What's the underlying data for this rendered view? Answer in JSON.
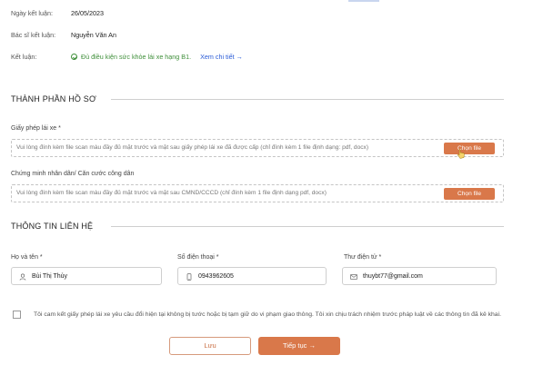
{
  "conclusion_info": {
    "date_label": "Ngày kết luận:",
    "date_value": "26/05/2023",
    "doctor_label": "Bác sĩ kết luận:",
    "doctor_value": "Nguyễn Văn An",
    "result_label": "Kết luận:",
    "result_value": "Đủ điều kiện sức khỏe lái xe hạng B1.",
    "detail_link": "Xem chi tiết",
    "detail_arrow": "→",
    "result_color": "#3f8f3a"
  },
  "documents": {
    "title": "THÀNH PHẦN HỒ SƠ",
    "license": {
      "label": "Giấy phép lái xe *",
      "hint": "Vui lòng đính kèm file scan màu đầy đủ mặt trước và mặt sau giấy phép lái xe đã được cấp (chỉ đính kèm 1 file định dạng: pdf, docx)",
      "button": "Chọn file"
    },
    "id_card": {
      "label": "Chứng minh nhân dân/ Căn cước công dân",
      "hint": "Vui lòng đính kèm file scan màu đầy đủ mặt trước và mặt sau CMND/CCCD (chỉ đính kèm 1 file định dạng pdf, docx)",
      "button": "Chọn file"
    }
  },
  "contact": {
    "title": "THÔNG TIN LIÊN HỆ",
    "name": {
      "label": "Họ và tên *",
      "value": "Bùi Thị Thủy",
      "icon": "user-icon"
    },
    "phone": {
      "label": "Số điện thoại *",
      "value": "0943962605",
      "icon": "phone-icon"
    },
    "email": {
      "label": "Thư điện tử *",
      "value": "thuybt77@gmail.com",
      "icon": "mail-icon"
    }
  },
  "commitment": {
    "checked": false,
    "text": "Tôi cam kết giấy phép lái xe yêu cầu đổi hiện tại không bị tước hoặc bị tạm giữ do vi phạm giao thông. Tôi xin chịu trách nhiệm trước pháp luật về các thông tin đã kê khai."
  },
  "actions": {
    "save": "Lưu",
    "next": "Tiếp tục",
    "next_arrow": "→"
  },
  "colors": {
    "accent": "#d9784a",
    "link": "#2a5bd7"
  }
}
